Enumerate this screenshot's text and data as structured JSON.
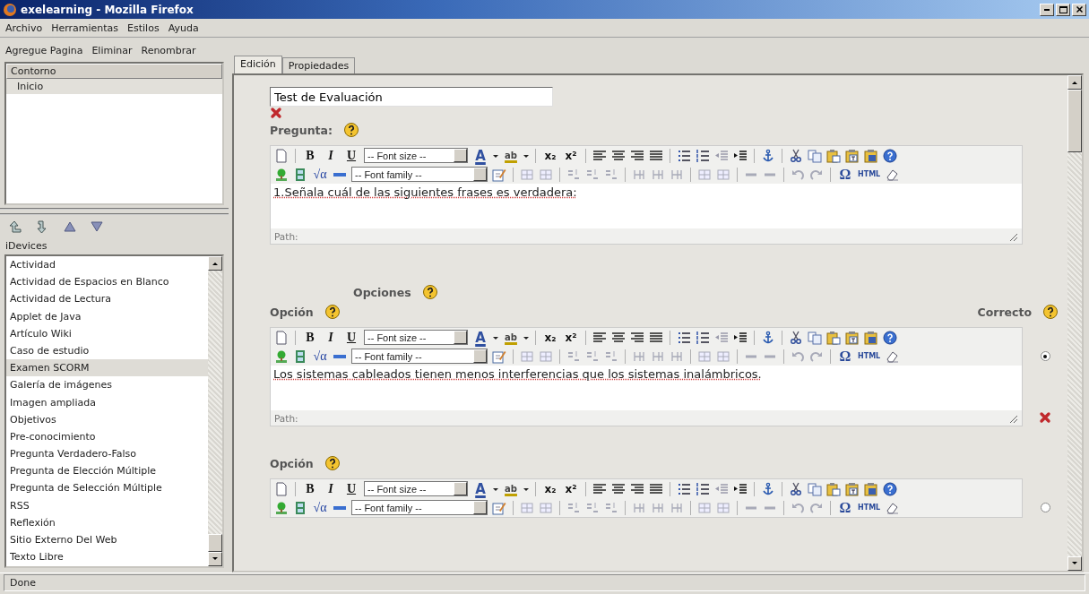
{
  "window": {
    "title": "exelearning - Mozilla Firefox"
  },
  "menu": [
    "Archivo",
    "Herramientas",
    "Estilos",
    "Ayuda"
  ],
  "outline_toolbar": [
    "Agregue Pagina",
    "Eliminar",
    "Renombrar"
  ],
  "outline": {
    "header": "Contorno",
    "items": [
      {
        "label": "Inicio",
        "selected": true
      }
    ]
  },
  "idevices": {
    "label": "iDevices",
    "items": [
      {
        "label": "Actividad",
        "selected": false
      },
      {
        "label": "Actividad de Espacios en Blanco",
        "selected": false
      },
      {
        "label": "Actividad de Lectura",
        "selected": false
      },
      {
        "label": "Applet de Java",
        "selected": false
      },
      {
        "label": "Artículo Wiki",
        "selected": false
      },
      {
        "label": "Caso de estudio",
        "selected": false
      },
      {
        "label": "Examen SCORM",
        "selected": true
      },
      {
        "label": "Galería de imágenes",
        "selected": false
      },
      {
        "label": "Imagen ampliada",
        "selected": false
      },
      {
        "label": "Objetivos",
        "selected": false
      },
      {
        "label": "Pre-conocimiento",
        "selected": false
      },
      {
        "label": "Pregunta Verdadero-Falso",
        "selected": false
      },
      {
        "label": "Pregunta de Elección Múltiple",
        "selected": false
      },
      {
        "label": "Pregunta de Selección Múltiple",
        "selected": false
      },
      {
        "label": "RSS",
        "selected": false
      },
      {
        "label": "Reflexión",
        "selected": false
      },
      {
        "label": "Sitio Externo Del Web",
        "selected": false
      },
      {
        "label": "Texto Libre",
        "selected": false
      }
    ]
  },
  "tabs": [
    {
      "label": "Edición",
      "selected": true
    },
    {
      "label": "Propiedades",
      "selected": false
    }
  ],
  "title_field": {
    "value": "Test de Evaluación"
  },
  "question": {
    "label": "Pregunta:",
    "editor": {
      "toolbar": {
        "bold": "B",
        "italic": "I",
        "underline": "U",
        "font_size": "-- Font size --",
        "text_color": "A",
        "highlight": "ab",
        "subscript": "x₂",
        "superscript": "x²",
        "math": "√α",
        "font_family": "-- Font family --",
        "special_char": "Ω",
        "html": "HTML"
      },
      "text": "1.Señala cuál de las siguientes frases es verdadera:",
      "path_label": "Path:"
    }
  },
  "options_heading": "Opciones",
  "correct_label": "Correcto",
  "options": [
    {
      "label": "Opción",
      "selected": true,
      "editor": {
        "toolbar": {
          "bold": "B",
          "italic": "I",
          "underline": "U",
          "font_size": "-- Font size --",
          "text_color": "A",
          "highlight": "ab",
          "subscript": "x₂",
          "superscript": "x²",
          "math": "√α",
          "font_family": "-- Font family --",
          "special_char": "Ω",
          "html": "HTML"
        },
        "text": "Los sistemas cableados tienen menos interferencias que los sistemas inalámbricos.",
        "path_label": "Path:"
      }
    },
    {
      "label": "Opción",
      "selected": false,
      "editor": {
        "toolbar": {
          "bold": "B",
          "italic": "I",
          "underline": "U",
          "font_size": "-- Font size --",
          "text_color": "A",
          "highlight": "ab",
          "subscript": "x₂",
          "superscript": "x²",
          "math": "√α",
          "font_family": "-- Font family --",
          "special_char": "Ω",
          "html": "HTML"
        }
      }
    }
  ],
  "status_bar": "Done"
}
